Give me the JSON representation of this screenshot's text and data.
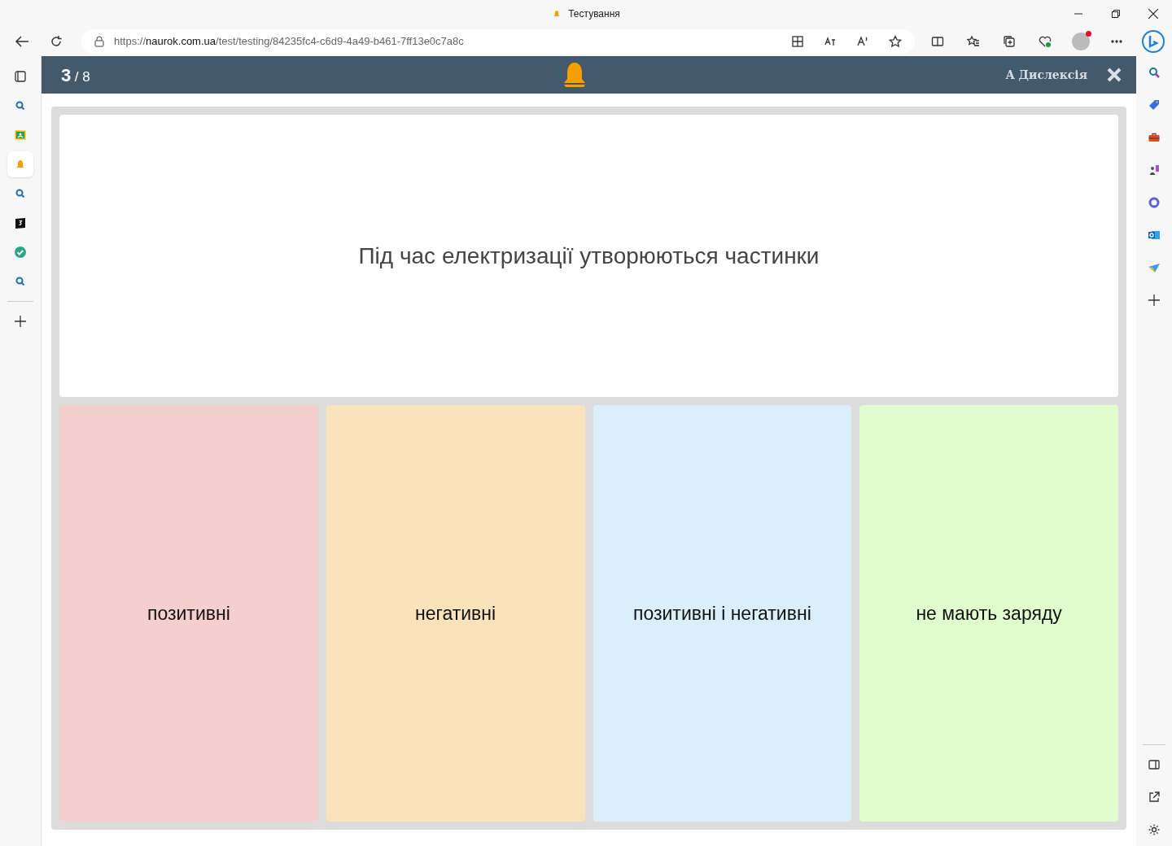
{
  "window": {
    "title": "Тестування"
  },
  "address_bar": {
    "scheme": "https://",
    "host": "naurok.com.ua",
    "path": "/test/testing/84235fc4-c6d9-4a49-b461-7ff13e0c7a8c"
  },
  "left_sidebar": [
    {
      "kind": "search",
      "selected": false
    },
    {
      "kind": "classroom",
      "selected": false
    },
    {
      "kind": "bell",
      "selected": true
    },
    {
      "kind": "search",
      "selected": false
    },
    {
      "kind": "number",
      "selected": false
    },
    {
      "kind": "check",
      "selected": false
    },
    {
      "kind": "search",
      "selected": false
    }
  ],
  "right_sidebar": [
    {
      "kind": "search"
    },
    {
      "kind": "tag"
    },
    {
      "kind": "toolbox"
    },
    {
      "kind": "chess"
    },
    {
      "kind": "copilot"
    },
    {
      "kind": "outlook"
    },
    {
      "kind": "send"
    }
  ],
  "quiz": {
    "current": "3",
    "total": "/ 8",
    "dyslexia": "A Дислексія",
    "question": "Під час електризації утворюються частинки",
    "answers": [
      {
        "text": "позитивні",
        "color": "#f5cece"
      },
      {
        "text": "негативні",
        "color": "#fae3b9"
      },
      {
        "text": "позитивні і негативні",
        "color": "#d9f0fa"
      },
      {
        "text": "не мають заряду",
        "color": "#e0fdcd"
      }
    ]
  }
}
